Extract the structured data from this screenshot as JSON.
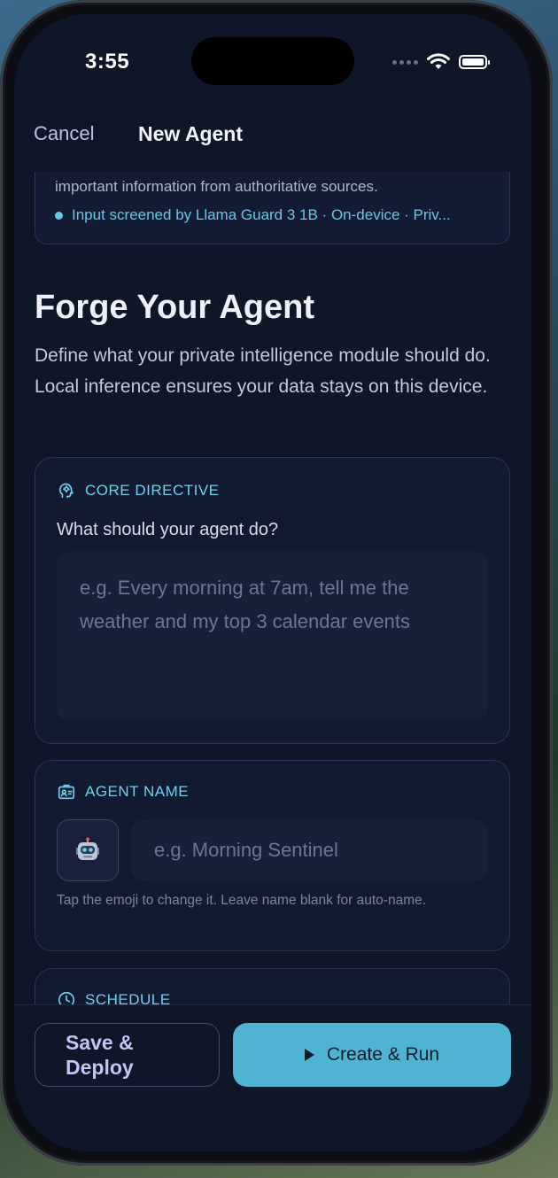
{
  "status_bar": {
    "time": "3:55"
  },
  "nav": {
    "cancel_label": "Cancel",
    "title": "New Agent"
  },
  "info_card": {
    "text": "important information from authoritative sources.",
    "guard_text": "Input screened by Llama Guard 3 1B · On-device · Priv..."
  },
  "intro": {
    "title": "Forge Your Agent",
    "description": "Define what your private intelligence module should do. Local inference ensures your data stays on this device."
  },
  "directive": {
    "header": "CORE DIRECTIVE",
    "question": "What should your agent do?",
    "placeholder": "e.g. Every morning at 7am, tell me the weather and my top 3 calendar events"
  },
  "agent_name": {
    "header": "AGENT NAME",
    "emoji_icon": "robot-emoji",
    "placeholder": "e.g. Morning Sentinel",
    "hint": "Tap the emoji to change it. Leave name blank for auto-name."
  },
  "schedule": {
    "header": "SCHEDULE"
  },
  "actions": {
    "save_label": "Save & Deploy",
    "run_label": "Create & Run"
  },
  "colors": {
    "accent": "#4fb3d4",
    "background": "#0f1627",
    "card": "#121a2f",
    "header_text": "#6fd0ef"
  }
}
